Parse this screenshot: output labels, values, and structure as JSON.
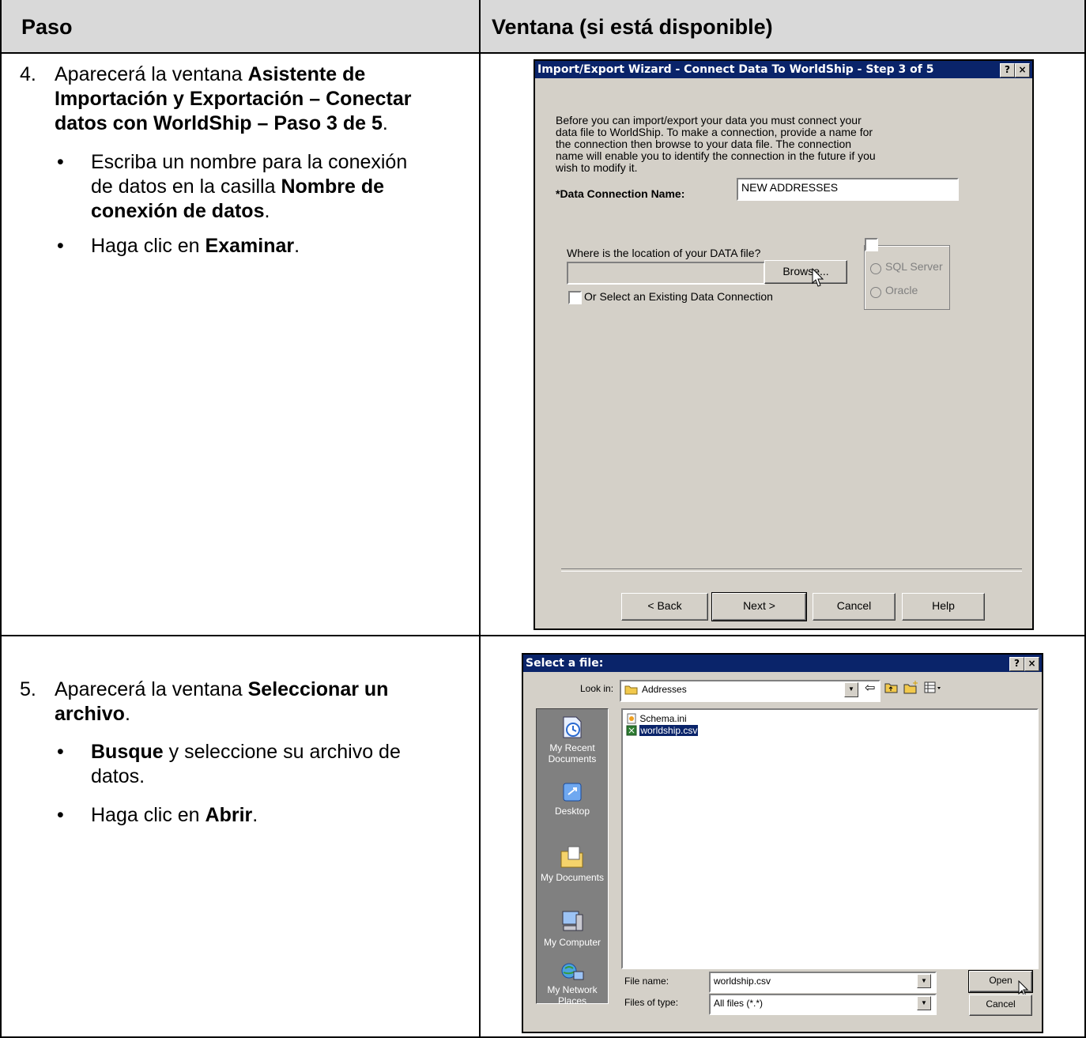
{
  "header": {
    "col1": "Paso",
    "col2": "Ventana (si está disponible)"
  },
  "step4": {
    "number": "4.",
    "line1_plain": "Aparecerá la ventana ",
    "line1_bold": "Asistente de",
    "line2_bold": "Importación y Exportación – Conectar",
    "line3_bold": "datos con WorldShip – Paso 3 de 5",
    "line3_tail": ".",
    "bullet1_line1": "Escriba un nombre para la conexión",
    "bullet1_line2_plain": "de datos en la casilla ",
    "bullet1_line2_bold": "Nombre de",
    "bullet1_line3_bold": "conexión de datos",
    "bullet1_line3_tail": ".",
    "bullet2_plain": "Haga clic en ",
    "bullet2_bold": "Examinar",
    "bullet2_tail": "."
  },
  "step5": {
    "number": "5.",
    "line1_plain": "Aparecerá la ventana ",
    "line1_bold": "Seleccionar un",
    "line2_bold": "archivo",
    "line2_tail": ".",
    "bullet1_bold": "Busque",
    "bullet1_plain": " y seleccione su archivo de",
    "bullet1_line2": "datos.",
    "bullet2_plain": "Haga clic en ",
    "bullet2_bold": "Abrir",
    "bullet2_tail": "."
  },
  "wizard": {
    "title": "Import/Export Wizard - Connect Data To WorldShip - Step 3 of 5",
    "help_btn": "?",
    "close_btn": "×",
    "intro_lines": [
      "Before you can import/export your data you must connect your",
      "data file to WorldShip. To make a connection, provide a name for",
      "the connection then browse to your data file. The connection",
      "name will enable you to identify the connection in the future if you",
      "wish to modify it."
    ],
    "name_label": "*Data Connection Name:",
    "name_value": "NEW ADDRESSES",
    "location_label": "Where is the location of your DATA file?",
    "location_value": "",
    "browse_label": "Browse...",
    "existing_label": "Or Select an Existing Data Connection",
    "sql_label": "SQL Server",
    "oracle_label": "Oracle",
    "back_label": "< Back",
    "next_label": "Next >",
    "cancel_label": "Cancel",
    "help_label": "Help"
  },
  "filedialog": {
    "title": "Select a file:",
    "help_btn": "?",
    "close_btn": "×",
    "lookin_label": "Look in:",
    "lookin_value": "Addresses",
    "places": [
      "My Recent Documents",
      "Desktop",
      "My Documents",
      "My Computer",
      "My Network Places"
    ],
    "files": [
      "Schema.ini",
      "worldship.csv"
    ],
    "filename_label": "File name:",
    "filename_value": "worldship.csv",
    "filetype_label": "Files of type:",
    "filetype_value": "All files (*.*)",
    "open_label": "Open",
    "cancel_label": "Cancel"
  }
}
